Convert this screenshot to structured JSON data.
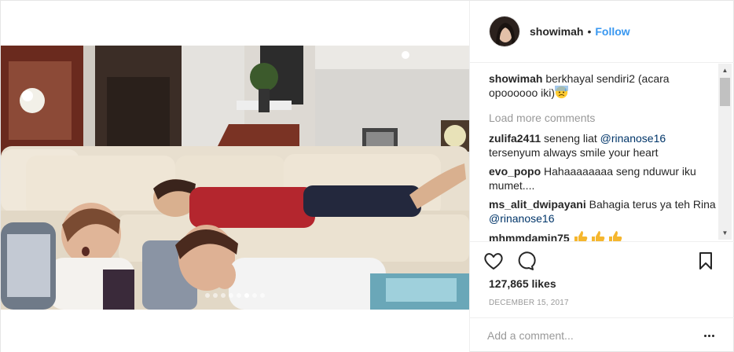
{
  "post": {
    "username": "showimah",
    "separator": "•",
    "follow_label": "Follow",
    "caption": {
      "username": "showimah",
      "text": "berkhayal sendiri2 (acara opoooooo iki)",
      "emoji": "sweat-face-emoji"
    },
    "load_more_label": "Load more comments",
    "comments": [
      {
        "username": "zulifa2411",
        "before": "seneng liat ",
        "mention": "@rinanose16",
        "after": " tersenyum always smile your heart"
      },
      {
        "username": "evo_popo",
        "before": "Hahaaaaaaaa seng nduwur iku mumet....",
        "mention": "",
        "after": ""
      },
      {
        "username": "ms_alit_dwipayani",
        "before": "Bahagia terus ya teh Rina ",
        "mention": "@rinanose16",
        "after": ""
      },
      {
        "username": "mhmmdamin75",
        "before": "",
        "mention": "",
        "after": "",
        "emoji": "thumbs-up-emoji x3"
      }
    ],
    "likes_text": "127,865 likes",
    "date_text": "DECEMBER 15, 2017",
    "comment_placeholder": "Add a comment...",
    "carousel": {
      "total": 8,
      "active_index": 5
    }
  },
  "colors": {
    "follow": "#3897f0",
    "mention": "#003569",
    "muted": "#999999",
    "text": "#262626",
    "border": "#efefef"
  }
}
